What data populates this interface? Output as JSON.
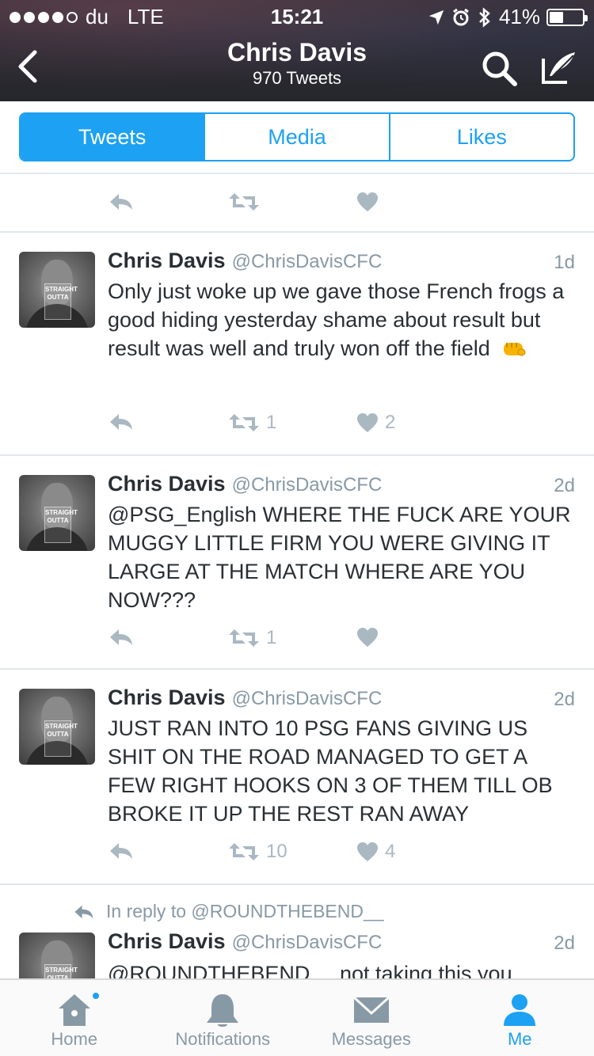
{
  "status_bar": {
    "carrier": "du",
    "network": "LTE",
    "time": "15:21",
    "battery": "41%",
    "icons": [
      "signal-dots-icon",
      "location-arrow-icon",
      "alarm-icon",
      "bluetooth-icon",
      "battery-icon"
    ]
  },
  "header": {
    "title": "Chris Davis",
    "subtitle": "970 Tweets",
    "back_icon": "chevron-left-icon",
    "search_icon": "search-icon",
    "compose_icon": "compose-tweet-icon"
  },
  "segments": [
    {
      "label": "Tweets",
      "active": true
    },
    {
      "label": "Media",
      "active": false
    },
    {
      "label": "Likes",
      "active": false
    }
  ],
  "partial_top_tweet": {
    "retweets": "",
    "likes": ""
  },
  "tweets": [
    {
      "name": "Chris Davis",
      "handle": "@ChrisDavisCFC",
      "time": "1d",
      "text": "Only just woke up we gave those French frogs a good hiding yesterday shame about result but result was well and truly won off the field",
      "emoji": "fist-emoji",
      "retweets": "1",
      "likes": "2"
    },
    {
      "name": "Chris Davis",
      "handle": "@ChrisDavisCFC",
      "time": "2d",
      "text": "@PSG_English WHERE THE FUCK ARE YOUR MUGGY LITTLE FIRM YOU WERE GIVING IT LARGE AT THE MATCH WHERE ARE YOU NOW???",
      "retweets": "1",
      "likes": ""
    },
    {
      "name": "Chris Davis",
      "handle": "@ChrisDavisCFC",
      "time": "2d",
      "text": "JUST RAN INTO 10 PSG FANS GIVING US SHIT ON THE ROAD MANAGED TO GET A FEW RIGHT HOOKS ON 3 OF THEM TILL OB BROKE IT UP THE REST RAN AWAY",
      "retweets": "10",
      "likes": "4"
    },
    {
      "in_reply_to": "In reply to @ROUNDTHEBEND__",
      "name": "Chris Davis",
      "handle": "@ChrisDavisCFC",
      "time": "2d",
      "text": "@ROUNDTHEBEND__ not taking this you"
    }
  ],
  "avatar_stamp": [
    "STRAIGHT",
    "OUTTA"
  ],
  "tabbar": [
    {
      "label": "Home",
      "icon": "home-icon",
      "active": false,
      "badge": true
    },
    {
      "label": "Notifications",
      "icon": "bell-icon",
      "active": false
    },
    {
      "label": "Messages",
      "icon": "envelope-icon",
      "active": false
    },
    {
      "label": "Me",
      "icon": "person-icon",
      "active": true
    }
  ],
  "colors": {
    "accent": "#1da1f2",
    "muted": "#8899a6",
    "action_gray": "#aab8c2",
    "text": "#292f33"
  }
}
